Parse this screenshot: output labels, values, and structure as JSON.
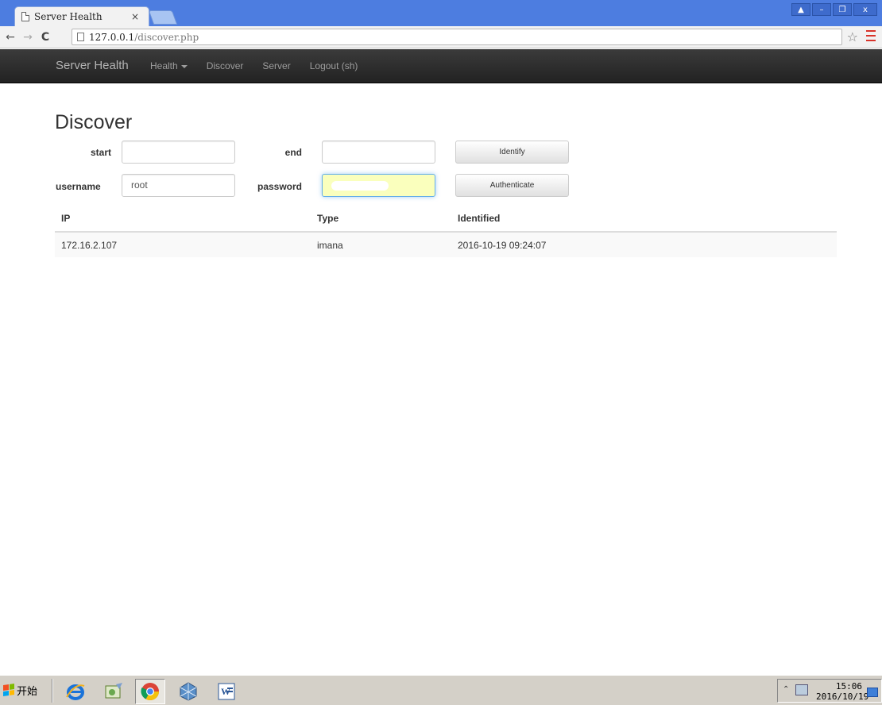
{
  "browser": {
    "tab_title": "Server Health",
    "tab_close": "×",
    "url_host": "127.0.0.1",
    "url_path": "/discover.php",
    "window_controls": [
      "▲",
      "–",
      "❐",
      "x"
    ]
  },
  "navbar": {
    "brand": "Server Health",
    "links": [
      {
        "label": "Health",
        "dropdown": true
      },
      {
        "label": "Discover"
      },
      {
        "label": "Server"
      },
      {
        "label": "Logout (sh)"
      }
    ]
  },
  "page": {
    "title": "Discover"
  },
  "form": {
    "start_label": "start",
    "start_value": "",
    "end_label": "end",
    "end_value": "",
    "identify_button": "Identify",
    "username_label": "username",
    "username_value": "root",
    "password_label": "password",
    "authenticate_button": "Authenticate"
  },
  "table": {
    "headers": [
      "IP",
      "Type",
      "Identified"
    ],
    "rows": [
      [
        "172.16.2.107",
        "imana",
        "2016-10-19 09:24:07"
      ]
    ]
  },
  "taskbar": {
    "start_label": "开始",
    "clock_time": "15:06",
    "clock_date": "2016/10/19",
    "icons": [
      "ie-icon",
      "paint-icon",
      "chrome-icon",
      "virtualbox-icon",
      "word-icon"
    ]
  },
  "colors": {
    "tabstrip": "#4d7de0",
    "navbar": "#222222",
    "autofill": "#faffbd"
  }
}
